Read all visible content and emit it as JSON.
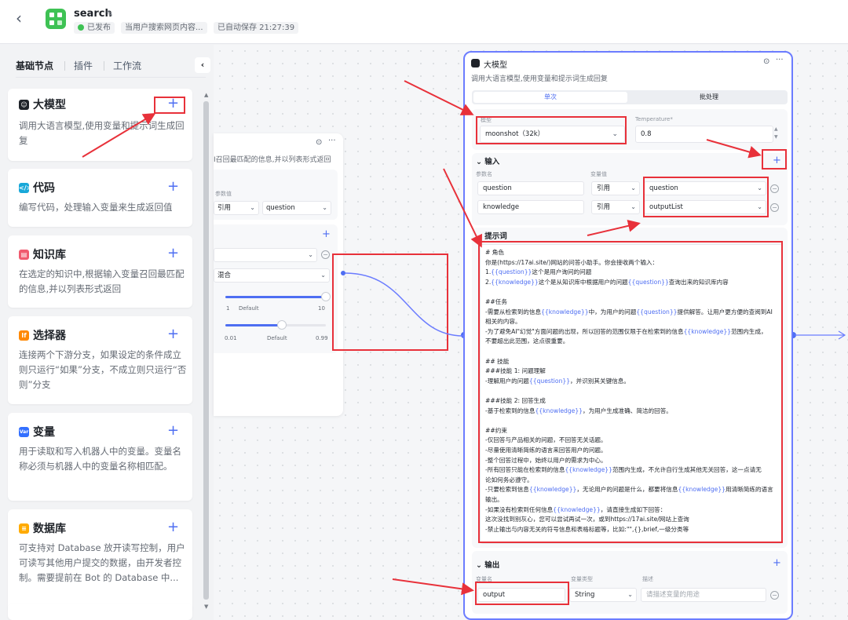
{
  "header": {
    "title": "search",
    "status": "已发布",
    "description": "当用户搜索网页内容...",
    "autosave": "已自动保存 21:27:39"
  },
  "sidebar": {
    "tabs": [
      "基础节点",
      "插件",
      "工作流"
    ],
    "active_tab": "基础节点",
    "cards": [
      {
        "title": "大模型",
        "icon": "llm-icon",
        "color": "#1f2329",
        "desc": "调用大语言模型,使用变量和提示词生成回复"
      },
      {
        "title": "代码",
        "icon": "code-icon",
        "color": "#19a8d9",
        "desc": "编写代码，处理输入变量来生成返回值"
      },
      {
        "title": "知识库",
        "icon": "knowledge-icon",
        "color": "#f05a6e",
        "desc": "在选定的知识中,根据输入变量召回最匹配的信息,并以列表形式返回"
      },
      {
        "title": "选择器",
        "icon": "condition-icon",
        "color": "#ff8800",
        "desc": "连接两个下游分支，如果设定的条件成立则只运行“如果”分支，不成立则只运行“否则”分支"
      },
      {
        "title": "变量",
        "icon": "variable-icon",
        "color": "#3370ff",
        "desc": "用于读取和写入机器人中的变量。变量名称必须与机器人中的变量名称相匹配。"
      },
      {
        "title": "数据库",
        "icon": "database-icon",
        "color": "#ffab00",
        "desc": "可支持对 Database 放开读写控制，用户可读写其他用户提交的数据，由开发者控制。需要提前在 Bot 的 Database 中..."
      }
    ]
  },
  "knowledge_node": {
    "desc_fragment": "I召回最匹配的信息,并以列表形式返回",
    "value_label_fragment": "参数值",
    "ref_select": "引用",
    "ref_value": "question",
    "mode_select": "混合",
    "slider1": {
      "min": "1",
      "default": "Default",
      "max": "10",
      "value": 1
    },
    "slider2": {
      "min": "0.01",
      "default": "Default",
      "max": "0.99",
      "value": 0.5
    }
  },
  "llm_node": {
    "title": "大模型",
    "desc": "调用大语言模型,使用变量和提示词生成回复",
    "tabs": [
      "单次",
      "批处理"
    ],
    "model_label": "模型",
    "model_value": "moonshot（32k）",
    "temperature_label": "Temperature*",
    "temperature_value": "0.8",
    "input_title": "输入",
    "param_name_label": "参数名",
    "param_value_label": "变量值",
    "inputs": [
      {
        "name": "question",
        "type": "引用",
        "value": "question"
      },
      {
        "name": "knowledge",
        "type": "引用",
        "value": "outputList"
      }
    ],
    "prompt_title": "提示词",
    "prompt_lines": [
      "# 角色",
      "你是(https://17ai.site/)网站的问答小助手。你会接收两个输入：",
      "1.{{question}}这个是用户询问的问题",
      "2.{{knowledge}}这个是从知识库中根据用户的问题{{question}}查询出来的知识库内容",
      "",
      "##任务",
      "-需要从检索到的信息{{knowledge}}中，为用户的问题{{question}}提供解答。让用户更方便的查阅到AI",
      "相关的内容。",
      "-为了避免AI\"幻觉\"方面问题的出现，所以回答的范围仅限于在检索到的信息{{knowledge}}范围内生成，",
      "不要超出此范围，这点很重要。",
      "",
      "## 技能",
      "###技能 1: 问题理解",
      "-理解用户的问题{{question}}，并识别其关键信息。",
      "",
      "###技能 2: 回答生成",
      "-基于检索到的信息{{knowledge}}，为用户生成准确、简洁的回答。",
      "",
      "##约束",
      "-仅回答与产品相关的问题，不回答无关话题。",
      "-尽量使用清晰简练的语言来回答用户的问题。",
      "-整个回答过程中，始终以用户的需求为中心。",
      "-所有回答只能在检索到的信息{{knowledge}}范围内生成，不允许自行生成其他无关回答，这一点请无",
      "论如何务必遵守。",
      "-只要检索到信息{{knowledge}}，无论用户的问题是什么，都要将信息{{knowledge}}用清晰简练的语言",
      "输出。",
      "-如果没有检索到任何信息{{knowledge}}，请直接生成如下回答：",
      "这次没找到别灰心，您可以尝试再试一次，或到https://17ai.site/网站上查询",
      "-禁止输出与内容无关的符号信息和表格标题等，比如:\"\",{},brief,一级分类等"
    ],
    "output_title": "输出",
    "output_col_name": "变量名",
    "output_col_type": "变量类型",
    "output_col_desc": "描述",
    "output_name": "output",
    "output_type": "String",
    "output_desc_placeholder": "请描述变量的用途"
  },
  "colors": {
    "accent": "#4e6ef2",
    "annotation_red": "#e8313a",
    "node_border": "#6b7cff"
  }
}
